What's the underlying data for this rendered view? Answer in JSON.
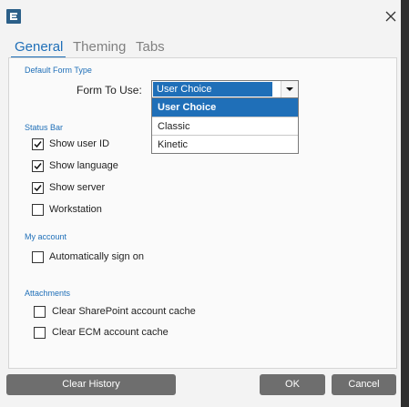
{
  "tabs": {
    "general": "General",
    "theming": "Theming",
    "tabs": "Tabs"
  },
  "form_type": {
    "section": "Default Form Type",
    "label": "Form To Use:",
    "selected": "User Choice",
    "options": [
      "User Choice",
      "Classic",
      "Kinetic"
    ]
  },
  "status_bar": {
    "section": "Status Bar",
    "items": [
      {
        "label": "Show user ID",
        "checked": true
      },
      {
        "label": "Show language",
        "checked": true
      },
      {
        "label": "Show server",
        "checked": true
      },
      {
        "label": "Workstation",
        "checked": false
      }
    ]
  },
  "my_account": {
    "section": "My account",
    "items": [
      {
        "label": "Automatically sign on",
        "checked": false
      }
    ]
  },
  "attachments": {
    "section": "Attachments",
    "items": [
      {
        "label": "Clear SharePoint account cache",
        "checked": false
      },
      {
        "label": "Clear ECM account cache",
        "checked": false
      }
    ]
  },
  "buttons": {
    "clear_history": "Clear History",
    "ok": "OK",
    "cancel": "Cancel"
  },
  "colors": {
    "accent": "#1f6fb8",
    "button": "#6e6e6e",
    "panel_border": "#d5d5d5"
  },
  "icons": {
    "app": "epicor-e-logo-icon",
    "close": "close-icon",
    "dropdown": "chevron-down-icon",
    "check": "checkmark-icon"
  }
}
